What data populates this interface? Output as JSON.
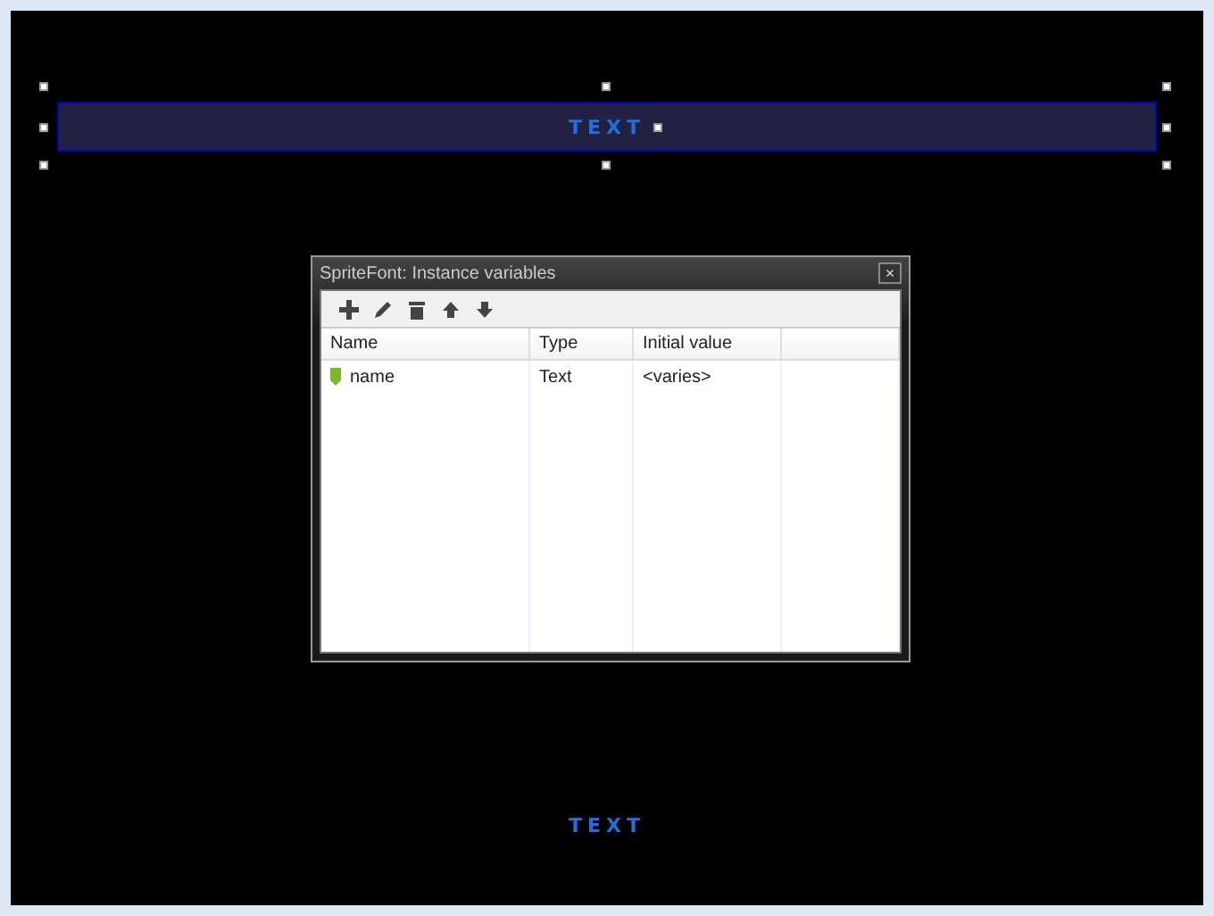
{
  "canvas_objects": [
    {
      "text": "TEXT",
      "selected": true
    },
    {
      "text": "TEXT",
      "selected": false
    }
  ],
  "dialog": {
    "title": "SpriteFont: Instance variables",
    "close": "×",
    "columns": [
      "Name",
      "Type",
      "Initial value"
    ],
    "rows": [
      {
        "name": "name",
        "type": "Text",
        "value": "<varies>"
      }
    ]
  }
}
